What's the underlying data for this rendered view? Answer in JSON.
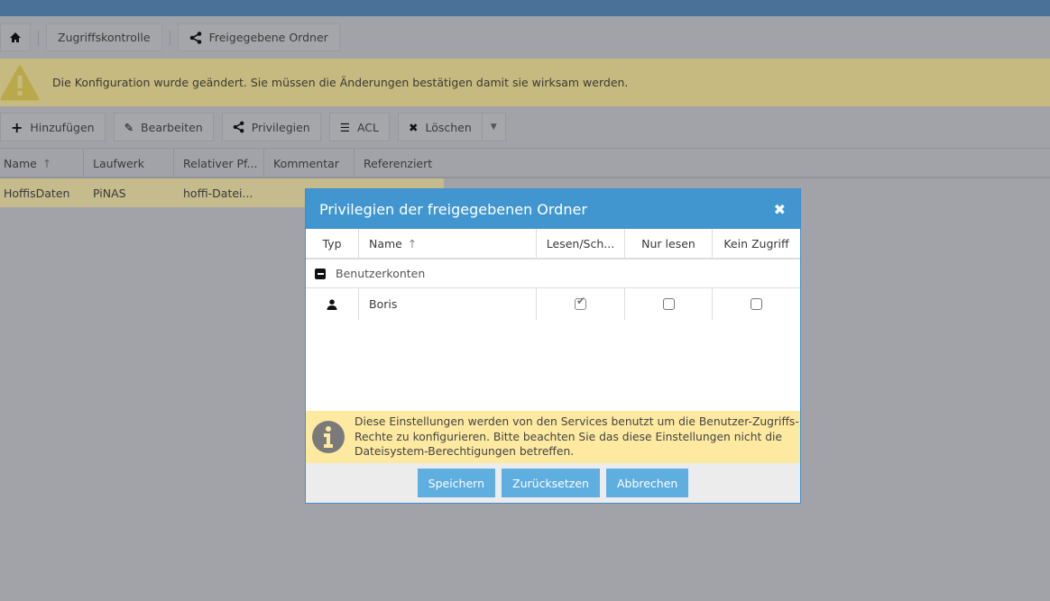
{
  "breadcrumb": {
    "items": [
      "Zugriffskontrolle",
      "Freigegebene Ordner"
    ]
  },
  "banner": {
    "text": "Die Konfiguration wurde geändert. Sie müssen die Änderungen bestätigen damit sie wirksam werden."
  },
  "toolbar": {
    "add": "Hinzufügen",
    "edit": "Bearbeiten",
    "privileges": "Privilegien",
    "acl": "ACL",
    "delete": "Löschen"
  },
  "grid": {
    "columns": [
      "Name",
      "Laufwerk",
      "Relativer Pf...",
      "Kommentar",
      "Referenziert"
    ],
    "rows": [
      {
        "name": "HoffisDaten",
        "drive": "PiNAS",
        "path": "hoffi-Datei...",
        "comment": "",
        "referenced": ""
      }
    ]
  },
  "modal": {
    "title": "Privilegien der freigegebenen Ordner",
    "columns": [
      "Typ",
      "Name",
      "Lesen/Sch...",
      "Nur lesen",
      "Kein Zugriff"
    ],
    "group": "Benutzerkonten",
    "rows": [
      {
        "name": "Boris",
        "read_write": true,
        "read_only": false,
        "no_access": false
      }
    ],
    "info": "Diese Einstellungen werden von den Services benutzt um die Benutzer-Zugriffs-Rechte zu konfigurieren. Bitte beachten Sie das diese Einstellungen nicht die Dateisystem-Berechtigungen betreffen.",
    "buttons": {
      "save": "Speichern",
      "reset": "Zurücksetzen",
      "cancel": "Abbrechen"
    }
  },
  "colors": {
    "accent": "#4196d0",
    "button": "#5eaee0",
    "info_bg": "#fde9a0"
  }
}
